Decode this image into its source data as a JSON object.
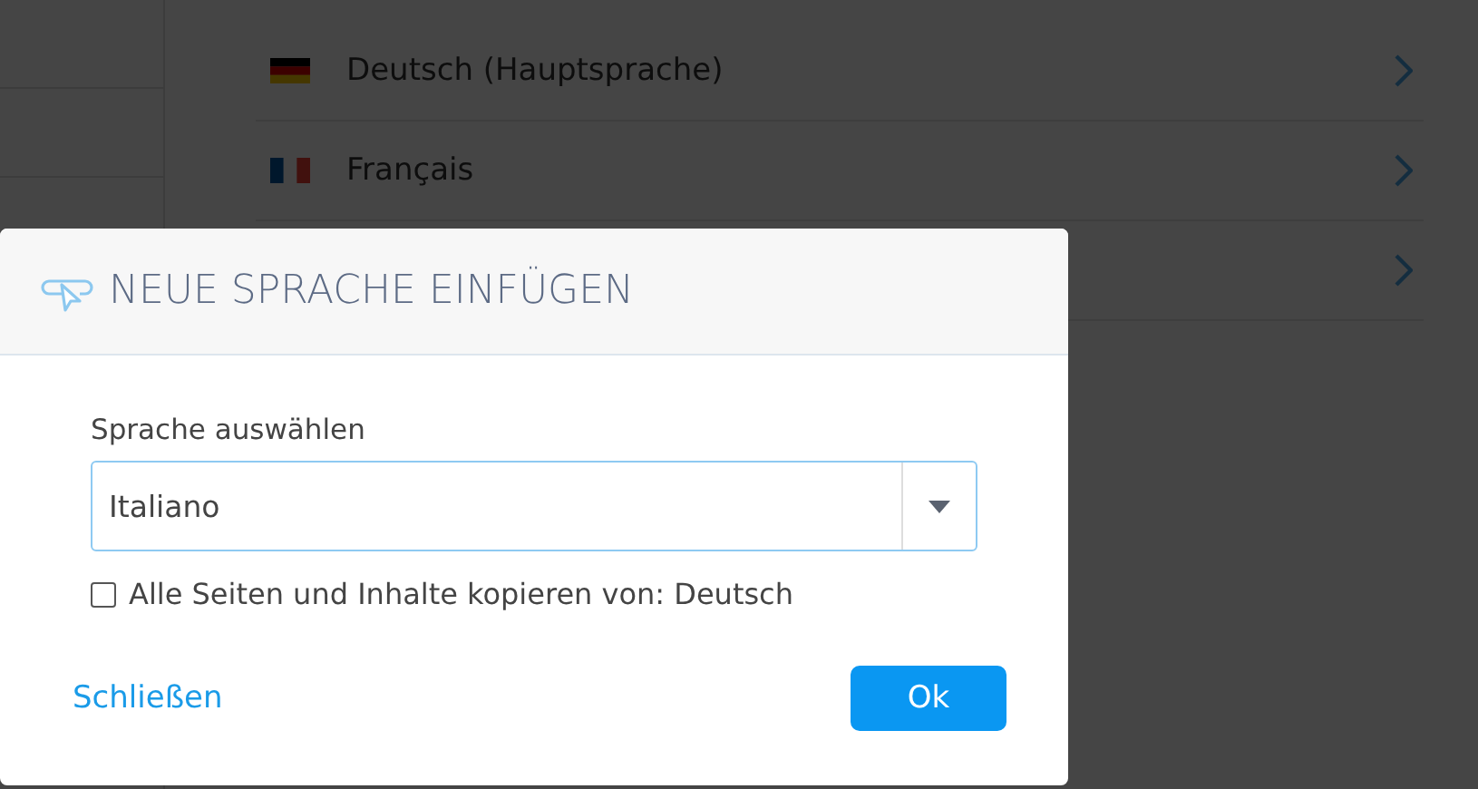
{
  "languages": [
    {
      "label": "Deutsch (Hauptsprache)",
      "kind": "de"
    },
    {
      "label": "Français",
      "kind": "fr"
    },
    {
      "kind": "blank"
    }
  ],
  "dialog": {
    "title": "NEUE SPRACHE EINFÜGEN",
    "field_label": "Sprache auswählen",
    "select": {
      "value": "Italiano"
    },
    "copy": {
      "label": "Alle Seiten und Inhalte kopieren von: Deutsch",
      "checked": false
    },
    "close": "Schließen",
    "ok": "Ok"
  }
}
